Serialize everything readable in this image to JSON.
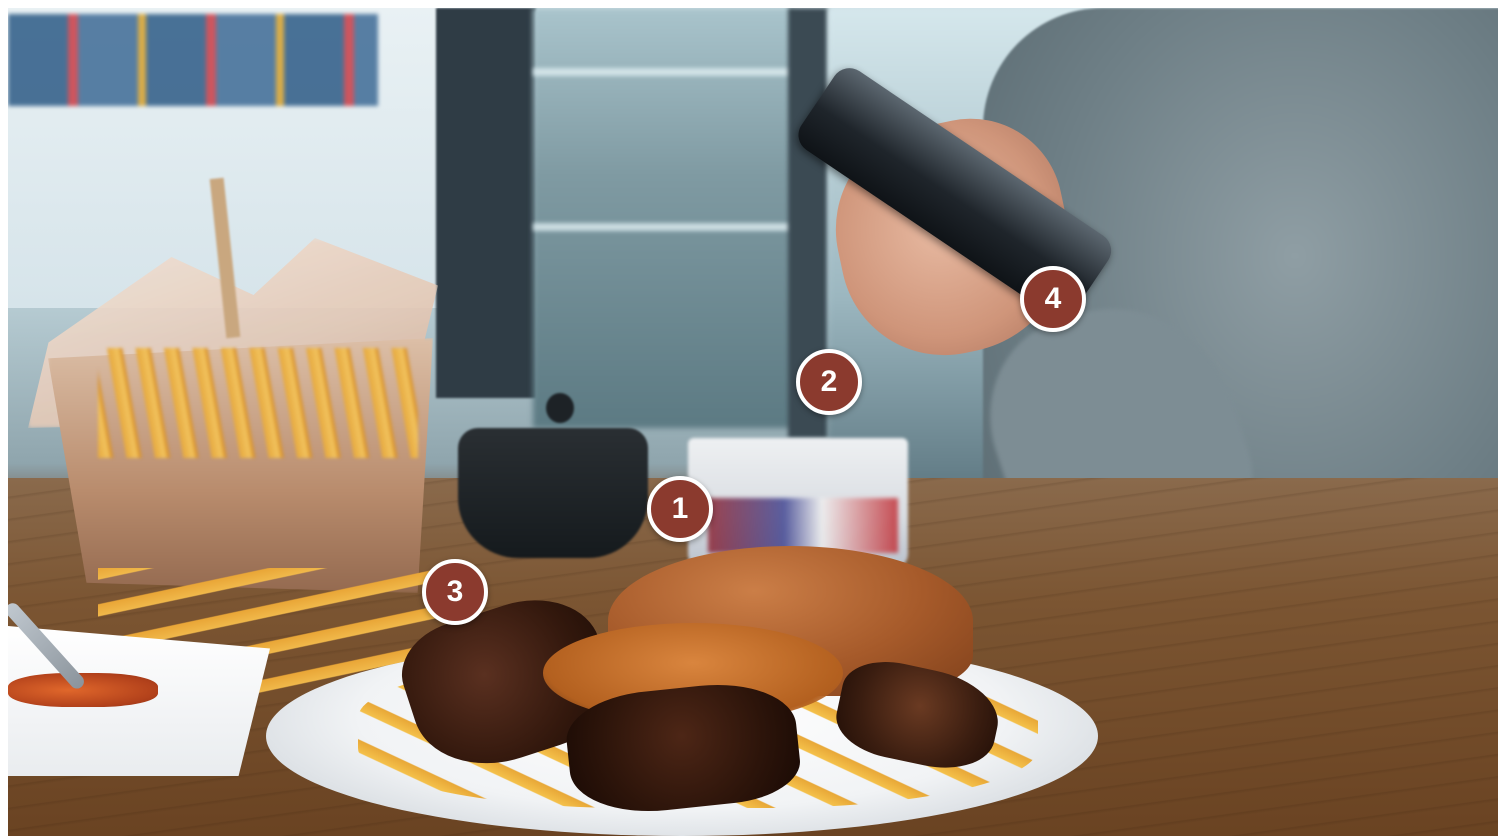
{
  "image": {
    "description_tags": [
      "photo-scene",
      "food-on-table",
      "phone-in-hand"
    ]
  },
  "markers": [
    {
      "label": "1",
      "target": "cup-behind-burger"
    },
    {
      "label": "2",
      "target": "area-above-cup"
    },
    {
      "label": "3",
      "target": "fries-on-table"
    },
    {
      "label": "4",
      "target": "hand-holding-phone"
    }
  ],
  "colors": {
    "marker_fill": "#8b3a2e",
    "marker_border": "#ffffff",
    "table_wood": "#7b5532",
    "plate": "#f1f3f5"
  }
}
